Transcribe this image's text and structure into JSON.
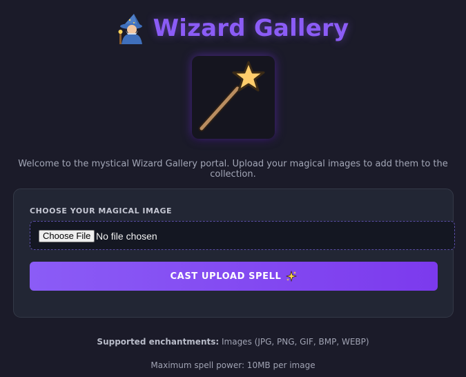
{
  "header": {
    "icon": "wizard-emoji",
    "title": "Wizard Gallery"
  },
  "hero": {
    "icon": "magic-wand-icon"
  },
  "welcome_text": "Welcome to the mystical Wizard Gallery portal. Upload your magical images to add them to the collection.",
  "upload_form": {
    "label": "CHOOSE YOUR MAGICAL IMAGE",
    "file_button_label": "Choose File",
    "file_status": "No file chosen",
    "submit_label": "CAST UPLOAD SPELL",
    "submit_icon": "sparkles-icon"
  },
  "footer": {
    "supported_label": "Supported enchantments:",
    "supported_value": " Images (JPG, PNG, GIF, BMP, WEBP)",
    "max_power": "Maximum spell power: 10MB per image"
  },
  "colors": {
    "background": "#1b1b29",
    "accent": "#8b5cf6",
    "card": "#222634"
  }
}
